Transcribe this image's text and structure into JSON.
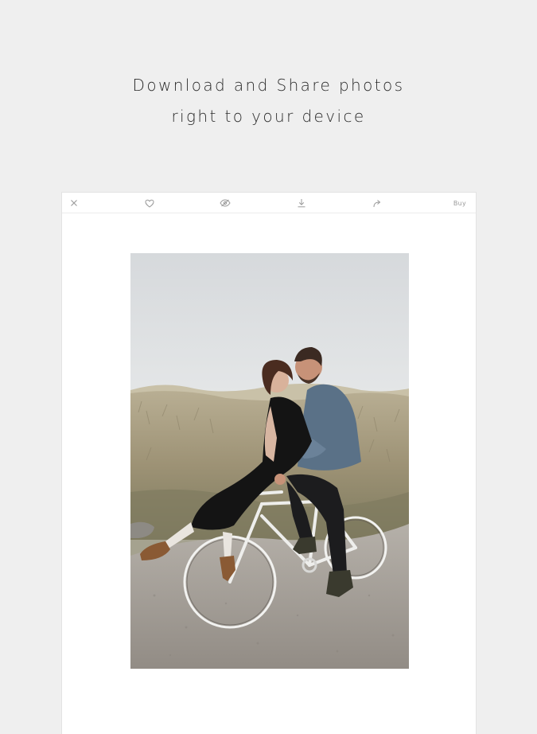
{
  "headline": {
    "line1": "Download and Share photos",
    "line2": "right to your device"
  },
  "toolbar": {
    "close_icon": "close-icon",
    "like_icon": "heart-icon",
    "hide_icon": "eye-off-icon",
    "download_icon": "download-icon",
    "share_icon": "share-icon",
    "buy_label": "Buy"
  },
  "photo": {
    "subject": "couple-riding-bicycle",
    "colors": {
      "sky": "#d9dcdf",
      "grass": "#a79c7f",
      "path": "#a8a39d"
    }
  },
  "colors": {
    "page_background": "#efefef",
    "card_background": "#ffffff",
    "headline_text": "#2b2b2b",
    "icon": "#9a9a9a"
  }
}
